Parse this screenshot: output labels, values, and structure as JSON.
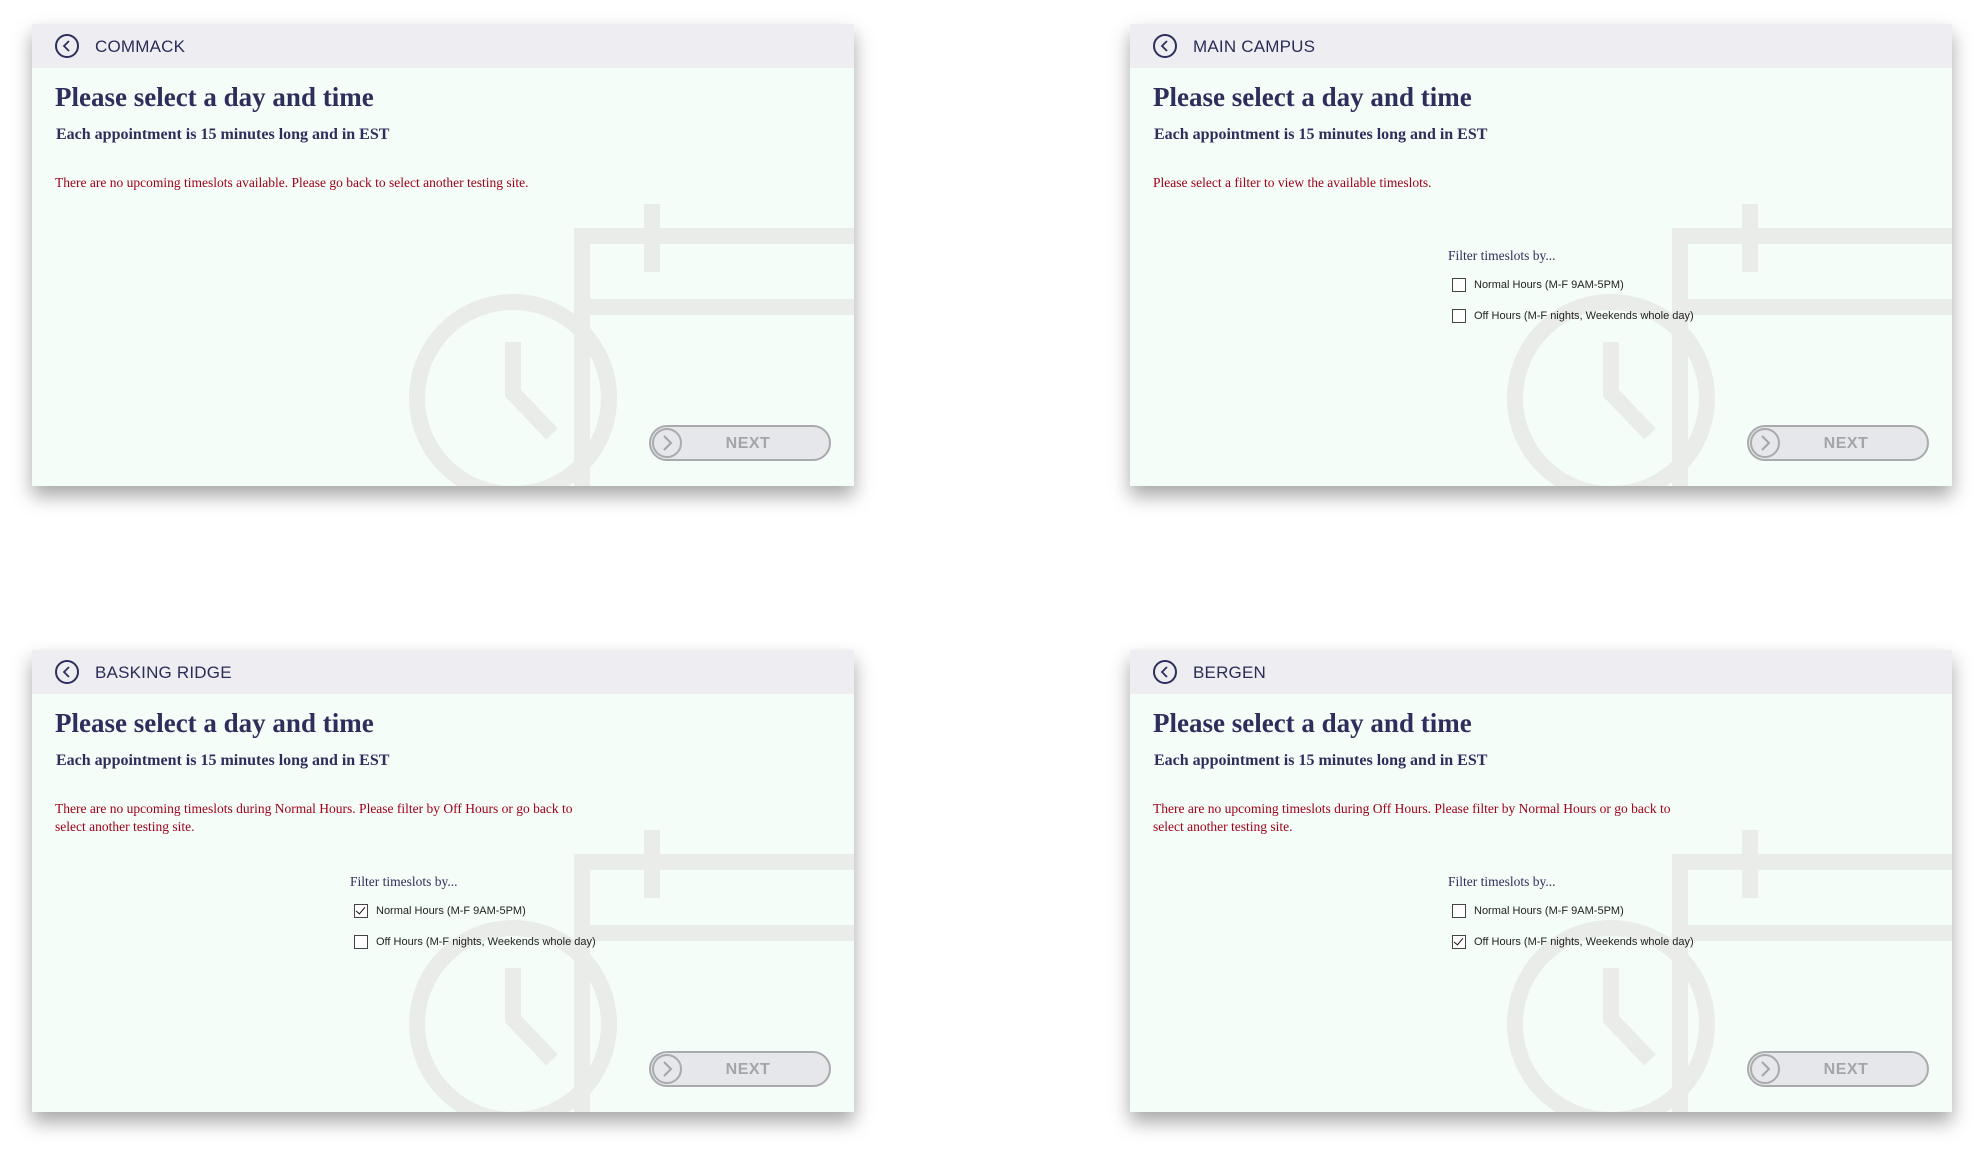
{
  "colors": {
    "title": "#2c2e5c",
    "error": "#a0001a",
    "panel_bg": "#f5fdf8",
    "header_bg": "#eeeef2",
    "disabled": "#a9aaae"
  },
  "icons": {
    "back": "chevron-left-circle-icon",
    "next": "chevron-right-circle-icon",
    "background": "calendar-clock-icon"
  },
  "panels": [
    {
      "site": "COMMACK",
      "title": "Please select a day and time",
      "subtitle": "Each appointment is 15 minutes long and in EST",
      "message": "There are no upcoming timeslots available. Please go back to select another testing site.",
      "next_label": "NEXT"
    },
    {
      "site": "MAIN CAMPUS",
      "title": "Please select a day and time",
      "subtitle": "Each appointment is 15 minutes long and in EST",
      "message": "Please select a filter to view the available timeslots.",
      "filter_title": "Filter timeslots by...",
      "options": [
        {
          "label": "Normal Hours (M-F 9AM-5PM)",
          "checked": false
        },
        {
          "label": "Off Hours (M-F nights, Weekends whole day)",
          "checked": false
        }
      ],
      "next_label": "NEXT"
    },
    {
      "site": "BASKING RIDGE",
      "title": "Please select a day and time",
      "subtitle": "Each appointment is 15 minutes long and in EST",
      "message": "There are no upcoming timeslots during Normal Hours. Please filter by Off Hours or go back to select another testing site.",
      "filter_title": "Filter timeslots by...",
      "options": [
        {
          "label": "Normal Hours (M-F 9AM-5PM)",
          "checked": true
        },
        {
          "label": "Off Hours (M-F nights, Weekends whole day)",
          "checked": false
        }
      ],
      "next_label": "NEXT"
    },
    {
      "site": "BERGEN",
      "title": "Please select a day and time",
      "subtitle": "Each appointment is 15 minutes long and in EST",
      "message": "There are no upcoming timeslots during Off Hours. Please filter by Normal Hours or go back to select another testing site.",
      "filter_title": "Filter timeslots by...",
      "options": [
        {
          "label": "Normal Hours (M-F 9AM-5PM)",
          "checked": false
        },
        {
          "label": "Off Hours (M-F nights, Weekends whole day)",
          "checked": true
        }
      ],
      "next_label": "NEXT"
    }
  ]
}
